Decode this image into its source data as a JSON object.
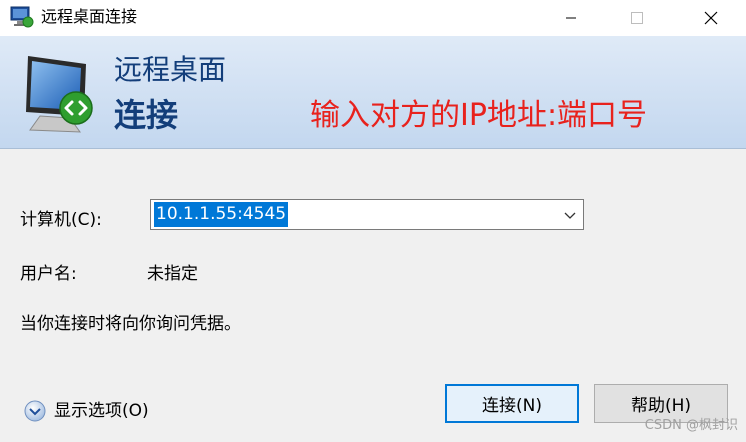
{
  "window": {
    "title": "远程桌面连接",
    "controls": [
      "minimize-icon",
      "maximize-icon",
      "close-icon"
    ]
  },
  "banner": {
    "line1": "远程桌面",
    "line2": "连接",
    "annotation": "输入对方的IP地址:端口号",
    "annotation_color": "#e8221d",
    "text_color": "#133e7a"
  },
  "form": {
    "computer_label": "计算机(C):",
    "computer_value": "10.1.1.55:4545",
    "username_label": "用户名:",
    "username_value": "未指定",
    "info_text": "当你连接时将向你询问凭据。"
  },
  "footer": {
    "options_label": "显示选项(O)",
    "connect_label": "连接(N)",
    "help_label": "帮助(H)"
  },
  "watermark": "CSDN @枫封识",
  "colors": {
    "accent": "#0078d7",
    "selection": "#0078d7"
  }
}
